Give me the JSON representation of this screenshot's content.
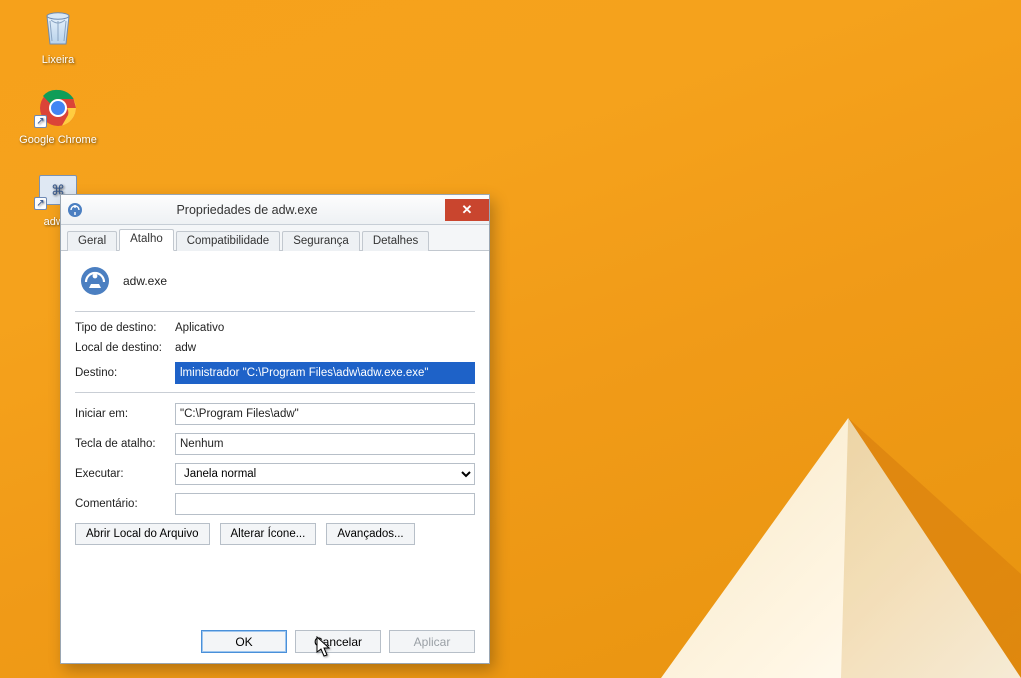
{
  "desktop": {
    "icons": {
      "recycle_label": "Lixeira",
      "chrome_label": "Google Chrome",
      "adw_label": "adw..."
    }
  },
  "dialog": {
    "title": "Propriedades de adw.exe",
    "tabs": {
      "general": "Geral",
      "shortcut": "Atalho",
      "compat": "Compatibilidade",
      "security": "Segurança",
      "details": "Detalhes"
    },
    "header": {
      "filename": "adw.exe"
    },
    "labels": {
      "target_type": "Tipo de destino:",
      "target_location": "Local de destino:",
      "target": "Destino:",
      "start_in": "Iniciar em:",
      "shortcut_key": "Tecla de atalho:",
      "run": "Executar:",
      "comment": "Comentário:"
    },
    "values": {
      "target_type": "Aplicativo",
      "target_location": "adw",
      "target": "lministrador \"C:\\Program Files\\adw\\adw.exe.exe\"",
      "start_in": "\"C:\\Program Files\\adw\"",
      "shortcut_key": "Nenhum",
      "run": "Janela normal",
      "comment": ""
    },
    "buttons": {
      "open_location": "Abrir Local do Arquivo",
      "change_icon": "Alterar Ícone...",
      "advanced": "Avançados...",
      "ok": "OK",
      "cancel": "Cancelar",
      "apply": "Aplicar"
    }
  }
}
